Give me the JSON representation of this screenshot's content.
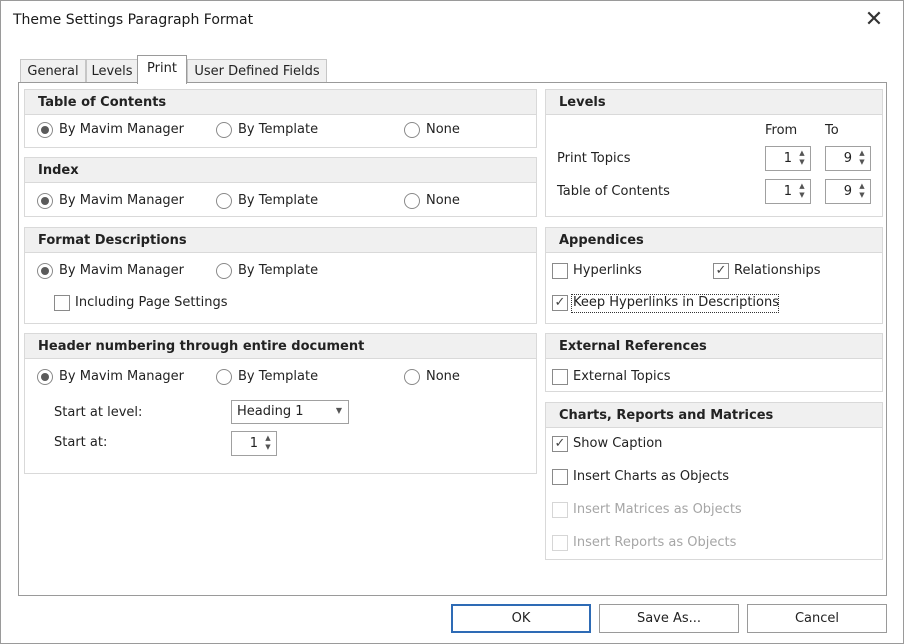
{
  "window": {
    "title": "Theme Settings Paragraph Format",
    "close_glyph": "✕"
  },
  "tabs": [
    "General",
    "Levels",
    "Print",
    "User Defined Fields"
  ],
  "toc": {
    "header": "Table of Contents",
    "options": [
      "By Mavim Manager",
      "By Template",
      "None"
    ],
    "selected": "By Mavim Manager"
  },
  "index": {
    "header": "Index",
    "options": [
      "By Mavim Manager",
      "By Template",
      "None"
    ],
    "selected": "By Mavim Manager"
  },
  "format_descriptions": {
    "header": "Format Descriptions",
    "options": [
      "By Mavim Manager",
      "By Template"
    ],
    "selected": "By Mavim Manager",
    "including_page_settings": "Including Page Settings"
  },
  "header_numbering": {
    "header": "Header numbering through entire document",
    "options": [
      "By Mavim Manager",
      "By Template",
      "None"
    ],
    "selected": "By Mavim Manager",
    "start_level_label": "Start at level:",
    "start_level_value": "Heading 1",
    "start_at_label": "Start at:",
    "start_at_value": "1"
  },
  "levels": {
    "header": "Levels",
    "from_label": "From",
    "to_label": "To",
    "print_topics_label": "Print Topics",
    "print_topics_from": "1",
    "print_topics_to": "9",
    "toc_label": "Table of Contents",
    "toc_from": "1",
    "toc_to": "9"
  },
  "appendices": {
    "header": "Appendices",
    "hyperlinks": "Hyperlinks",
    "relationships": "Relationships",
    "keep_hyperlinks": "Keep Hyperlinks in Descriptions"
  },
  "external_refs": {
    "header": "External References",
    "external_topics": "External Topics"
  },
  "charts": {
    "header": "Charts, Reports and Matrices",
    "show_caption": "Show Caption",
    "insert_charts": "Insert Charts as Objects",
    "insert_matrices": "Insert Matrices as Objects",
    "insert_reports": "Insert Reports as Objects"
  },
  "buttons": {
    "ok": "OK",
    "save_as": "Save As...",
    "cancel": "Cancel"
  },
  "glyphs": {
    "check": "✓",
    "spin_up": "▲",
    "spin_down": "▼",
    "combo_arrow": "▼"
  },
  "colors": {
    "default_button_border": "#2e6bb5",
    "group_header_bg": "#f0f0f0"
  }
}
